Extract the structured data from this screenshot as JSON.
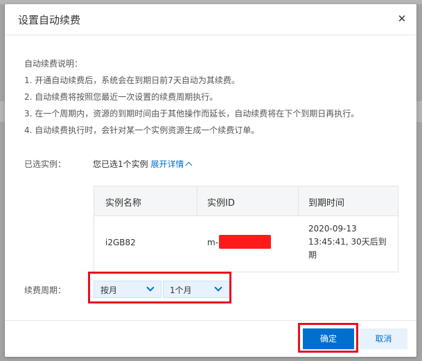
{
  "dialog": {
    "title": "设置自动续费",
    "close_glyph": "✕"
  },
  "notes": {
    "heading": "自动续费说明：",
    "items": [
      "1. 开通自动续费后，系统会在到期日前7天自动为其续费。",
      "2. 自动续费将按照您最近一次设置的续费周期执行。",
      "3. 在一个周期内，资源的到期时间由于其他操作而延长，自动续费将在下个到期日再执行。",
      "4. 自动续费执行时，会针对某一个实例资源生成一个续费订单。"
    ]
  },
  "selected_instances": {
    "label": "已选实例：",
    "summary": "您已选1个实例",
    "expand_link": "展开详情"
  },
  "table": {
    "headers": [
      "实例名称",
      "实例ID",
      "到期时间"
    ],
    "rows": [
      {
        "name": "i2GB82",
        "id_visible": "m-",
        "expiry_line1": "2020-09-13",
        "expiry_line2": "13:45:41, 30天后到",
        "expiry_line3": "期"
      }
    ]
  },
  "renewal_period": {
    "label": "续费周期：",
    "unit_select": "按月",
    "duration_select": "1个月"
  },
  "footer": {
    "confirm_label": "确定",
    "cancel_label": "取消"
  },
  "colors": {
    "accent": "#0070cc",
    "highlight": "#e8101f",
    "redaction": "#ff1a1a"
  }
}
